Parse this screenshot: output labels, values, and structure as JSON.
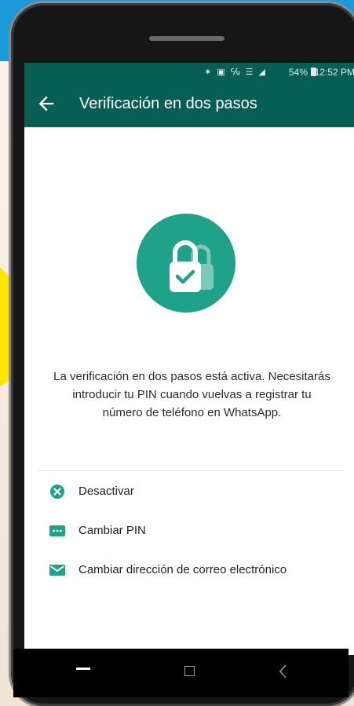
{
  "status_bar": {
    "icons": "⁕ ▣ ℆ ☰ ◢",
    "battery": "54%",
    "time": "12:52 PM"
  },
  "app_bar": {
    "title": "Verificación en dos pasos",
    "back_icon": "arrow-back-icon"
  },
  "main": {
    "lock_icon": "lock-check-icon",
    "description_lines": [
      "La verificación en dos pasos está activa. Necesitarás",
      "introducir tu PIN cuando vuelvas a registrar tu",
      "número de teléfono en WhatsApp."
    ],
    "options": [
      {
        "label": "Desactivar",
        "icon": "close-circle-icon"
      },
      {
        "label": "Cambiar PIN",
        "icon": "pin-dots-icon"
      },
      {
        "label": "Cambiar dirección de correo electrónico",
        "icon": "email-icon"
      }
    ]
  },
  "colors": {
    "app_bar": "#075e54",
    "accent": "#1fa28a",
    "background_blue": "#1a9ad8",
    "highlight_arrow": "#ffe600"
  }
}
